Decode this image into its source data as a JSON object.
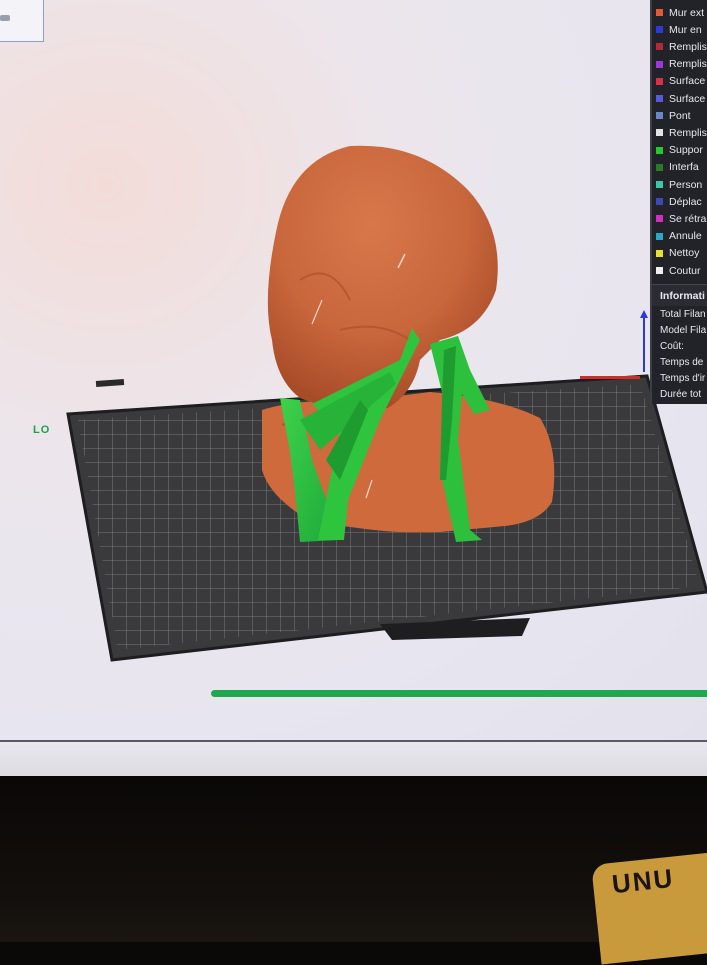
{
  "viewport": {
    "axis_label": "LO"
  },
  "legend": {
    "items": [
      {
        "label": "Mur ext",
        "color": "#e05a3a"
      },
      {
        "label": "Mur en",
        "color": "#2e3ad8"
      },
      {
        "label": "Rempliss",
        "color": "#b02a3a"
      },
      {
        "label": "Rempliss",
        "color": "#9a3ad0"
      },
      {
        "label": "Surface",
        "color": "#d8304a"
      },
      {
        "label": "Surface",
        "color": "#5a5ad8"
      },
      {
        "label": "Pont",
        "color": "#6a86c8"
      },
      {
        "label": "Rempliss",
        "color": "#e4e4e4"
      },
      {
        "label": "Suppor",
        "color": "#28c828"
      },
      {
        "label": "Interfa",
        "color": "#2a7a2a"
      },
      {
        "label": "Person",
        "color": "#3ac8a8"
      },
      {
        "label": "Déplac",
        "color": "#3a4ab0"
      },
      {
        "label": "Se rétra",
        "color": "#d030c0"
      },
      {
        "label": "Annule",
        "color": "#2aa8c8"
      },
      {
        "label": "Nettoy",
        "color": "#e8e030"
      },
      {
        "label": "Coutur",
        "color": "#f0f0f0"
      }
    ]
  },
  "info": {
    "title": "Informati",
    "rows": [
      "Total Filan",
      "Model Fila",
      "Coût:",
      "Temps de",
      "Temps d'ir",
      "Durée tot"
    ]
  },
  "progress": {
    "fraction": 1.0,
    "color": "#1ea84f"
  },
  "background": {
    "mug_text": "UNU"
  }
}
